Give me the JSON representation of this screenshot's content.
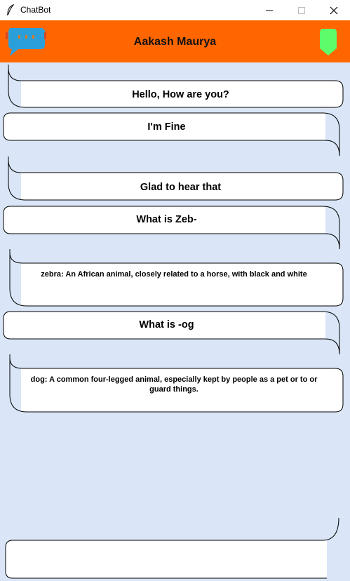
{
  "window": {
    "title": "ChatBot"
  },
  "header": {
    "name": "Aakash Maurya"
  },
  "messages": [
    {
      "side": "bot",
      "text": "Hello, How are you?"
    },
    {
      "side": "user",
      "text": "I'm Fine"
    },
    {
      "side": "bot",
      "text": "Glad to hear that"
    },
    {
      "side": "user",
      "text": "What is Zeb-"
    },
    {
      "side": "bot",
      "text": "zebra: An African animal, closely related to a horse, with black and white"
    },
    {
      "side": "user",
      "text": "What is -og"
    },
    {
      "side": "bot",
      "text": "dog: A common four-legged animal, especially kept by people as a pet or to or guard things."
    }
  ],
  "input": {
    "value": ""
  },
  "colors": {
    "header": "#ff6600",
    "background": "#dae6f7",
    "logo": "#2b9fd9",
    "status": "#5dfc6a"
  }
}
